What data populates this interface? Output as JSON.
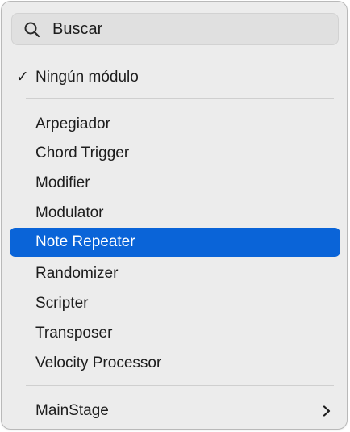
{
  "search": {
    "placeholder": "Buscar",
    "icon": "search-icon"
  },
  "current": {
    "check": "✓",
    "label": "Ningún módulo"
  },
  "modules": [
    {
      "label": "Arpegiador"
    },
    {
      "label": "Chord Trigger"
    },
    {
      "label": "Modifier"
    },
    {
      "label": "Modulator"
    },
    {
      "label": "Note Repeater",
      "highlighted": true
    },
    {
      "label": "Randomizer"
    },
    {
      "label": "Scripter"
    },
    {
      "label": "Transposer"
    },
    {
      "label": "Velocity Processor"
    }
  ],
  "submenu": {
    "label": "MainStage",
    "icon": "chevron-right-icon"
  },
  "colors": {
    "highlight": "#0a64d8",
    "menu_background": "#ececec"
  }
}
